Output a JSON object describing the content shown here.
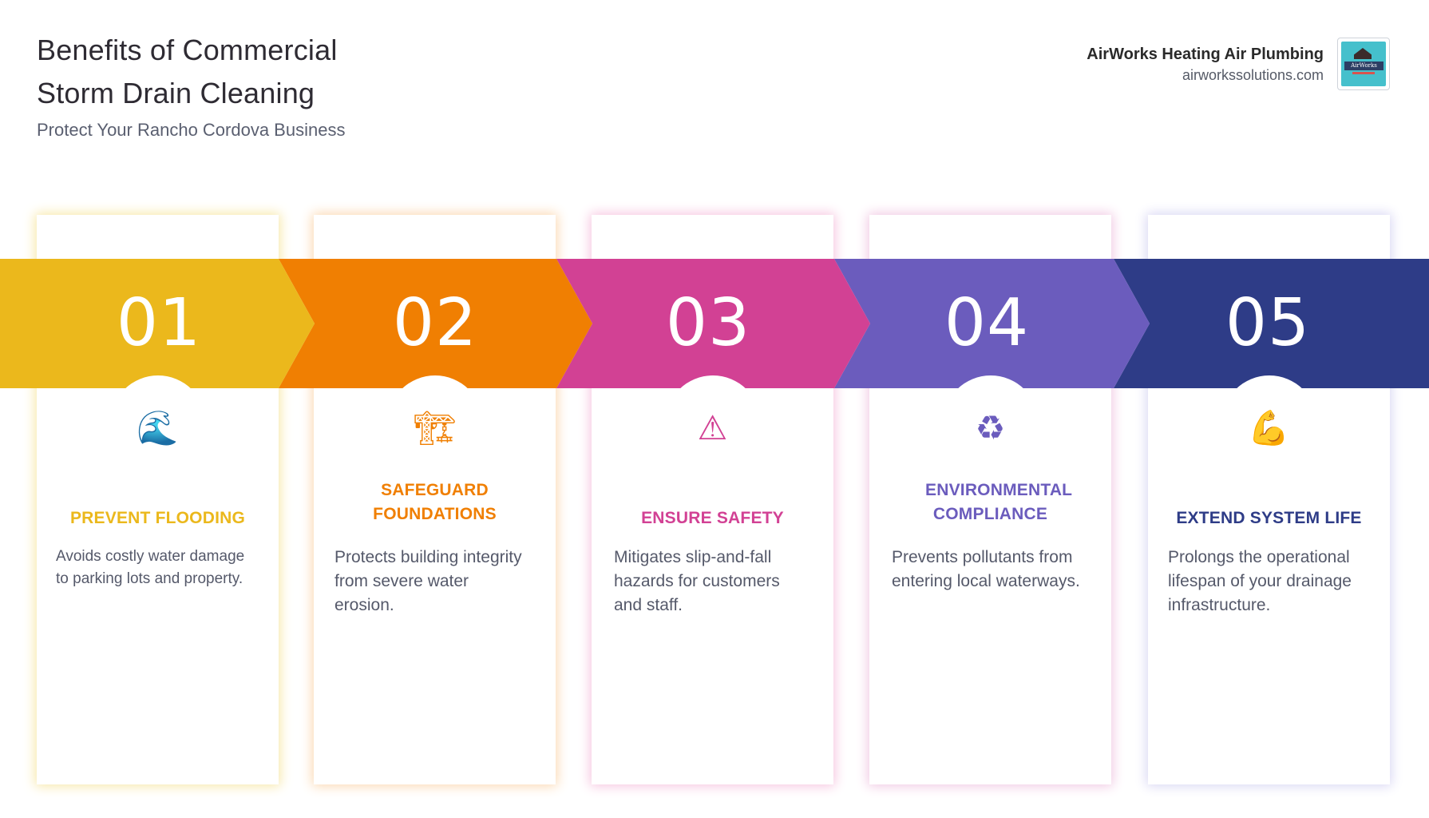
{
  "header": {
    "title": "Benefits of Commercial Storm Drain Cleaning",
    "subtitle": "Protect Your Rancho Cordova Business"
  },
  "brand": {
    "name": "AirWorks Heating Air Plumbing",
    "url": "airworkssolutions.com",
    "logo_text": "AirWorks"
  },
  "steps": [
    {
      "number": "01",
      "icon": "wave-icon",
      "glyph": "🌊",
      "heading": "PREVENT FLOODING",
      "description": "Avoids costly water damage to parking lots and property.",
      "color": "#ebb81c",
      "card_glow": "#f7e7a6"
    },
    {
      "number": "02",
      "icon": "crane-icon",
      "glyph": "🏗",
      "heading": "SAFEGUARD FOUNDATIONS",
      "description": "Protects building integrity from severe water erosion.",
      "color": "#f07f02",
      "card_glow": "#fbd8b1"
    },
    {
      "number": "03",
      "icon": "warning-icon",
      "glyph": "⚠",
      "heading": "ENSURE SAFETY",
      "description": "Mitigates slip-and-fall hazards for customers and staff.",
      "color": "#d24194",
      "card_glow": "#f6c4df"
    },
    {
      "number": "04",
      "icon": "recycle-icon",
      "glyph": "♻",
      "heading": "ENVIRONMENTAL COMPLIANCE",
      "description": "Prevents pollutants from entering local waterways.",
      "color": "#6b5cbd",
      "card_glow": "#f0c7e2"
    },
    {
      "number": "05",
      "icon": "flexed-biceps-icon",
      "glyph": "💪",
      "heading": "EXTEND SYSTEM LIFE",
      "description": "Prolongs the operational lifespan of your drainage infrastructure.",
      "color": "#2e3c87",
      "card_glow": "#d8d6f3"
    }
  ]
}
